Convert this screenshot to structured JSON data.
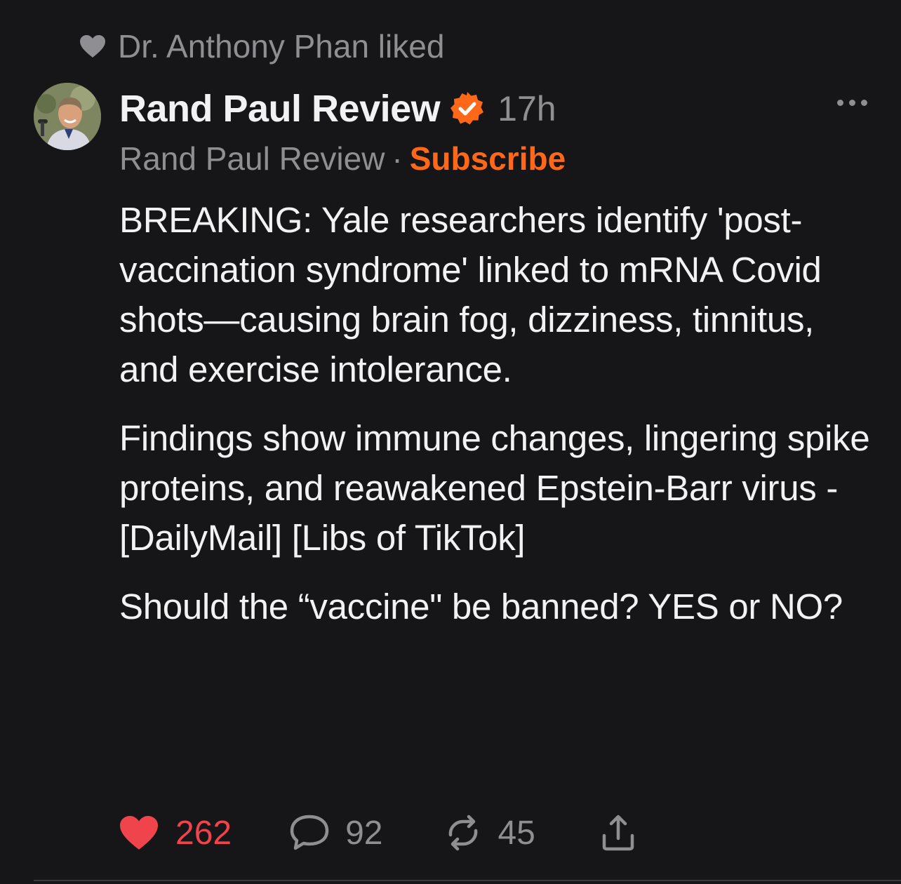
{
  "activity": {
    "liked_by_text": "Dr. Anthony Phan liked"
  },
  "post": {
    "author_name": "Rand Paul Review",
    "verified": true,
    "time_ago": "17h",
    "publication_name": "Rand Paul Review",
    "separator": "·",
    "subscribe_label": "Subscribe",
    "paragraphs": [
      "BREAKING: Yale researchers identify 'post-vaccination syndrome' linked to mRNA Covid shots—causing brain fog, dizziness, tinnitus, and exercise intolerance.",
      "Findings show immune changes, lingering spike proteins, and reawakened Epstein-Barr virus - [DailyMail] [Libs of TikTok]",
      "Should the “vaccine\" be banned? YES or NO?"
    ]
  },
  "actions": {
    "likes": "262",
    "replies": "92",
    "reposts": "45"
  },
  "icons": {
    "liked": "heart-icon",
    "verified": "verified-badge-icon",
    "more": "more-horizontal-icon",
    "like": "heart-filled-icon",
    "reply": "comment-bubble-icon",
    "repost": "repost-icon",
    "share": "share-icon"
  },
  "colors": {
    "background": "#161618",
    "accent_orange": "#ff6719",
    "like_red": "#f0444c",
    "muted": "#8e8e93",
    "text": "#f2f2f2"
  }
}
